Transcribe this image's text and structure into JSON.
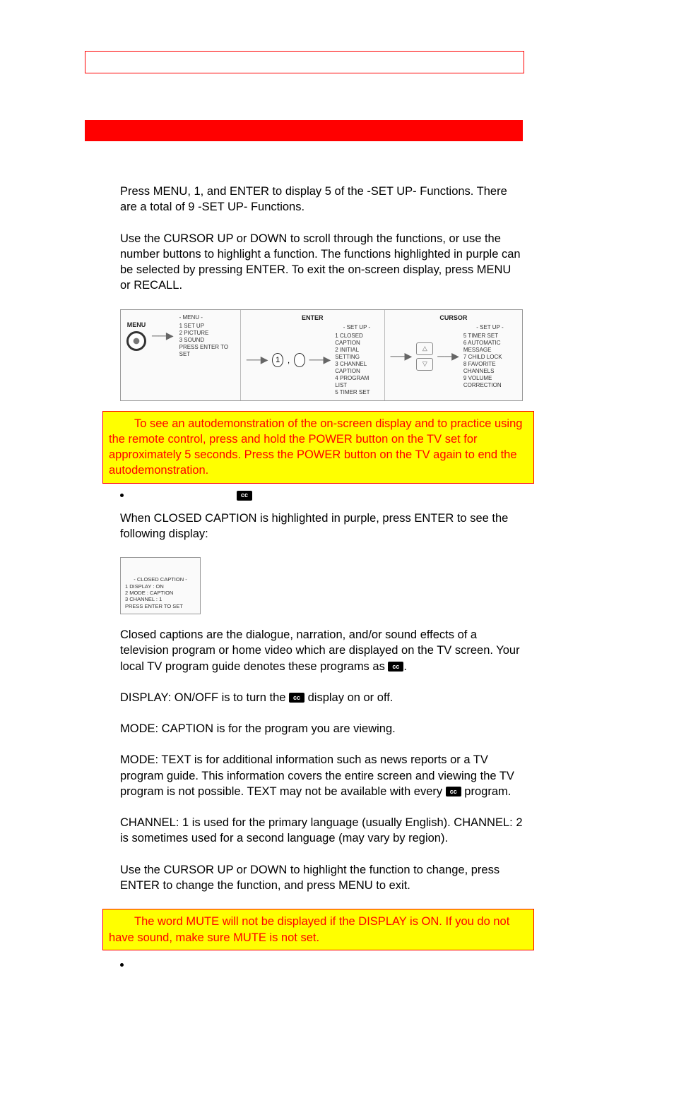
{
  "intro": {
    "p1": "Press MENU, 1, and ENTER to display 5 of the -SET UP- Functions. There are a total of 9 -SET UP- Functions.",
    "p2": "Use the CURSOR UP or DOWN to scroll through the functions, or use the number buttons to highlight a function. The functions highlighted in purple can be selected by pressing ENTER. To exit the on-screen display, press MENU or RECALL."
  },
  "diagram": {
    "menu_label": "MENU",
    "enter_label": "ENTER",
    "cursor_label": "CURSOR",
    "num1": "1",
    "comma": ",",
    "menu_screen": {
      "title": "- MENU -",
      "items": [
        "1  SET UP",
        "2  PICTURE",
        "3  SOUND"
      ],
      "footer": "PRESS ENTER TO SET"
    },
    "setup_screen_1": {
      "title": "- SET UP -",
      "items": [
        "1  CLOSED CAPTION",
        "2  INITIAL SETTING",
        "3  CHANNEL CAPTION",
        "4  PROGRAM LIST",
        "5  TIMER SET"
      ]
    },
    "setup_screen_2": {
      "title": "- SET UP -",
      "items": [
        "5  TIMER SET",
        "6  AUTOMATIC MESSAGE",
        "7  CHILD LOCK",
        "8  FAVORITE CHANNELS",
        "9  VOLUME CORRECTION"
      ]
    },
    "cursor_up": "△",
    "cursor_down": "▽"
  },
  "note1": "To see an autodemonstration of the on-screen display and to practice using the remote control, press and hold the POWER button on the TV set for approximately 5 seconds. Press the POWER button on the TV again to end the autodemonstration.",
  "closed_caption": {
    "heading_icon_name": "closed-caption-icon",
    "p1": "When CLOSED CAPTION is highlighted in purple, press ENTER to see the following display:",
    "screen": {
      "title": "- CLOSED CAPTION -",
      "items": [
        "1  DISPLAY   : ON",
        "2  MODE        : CAPTION",
        "3  CHANNEL : 1"
      ],
      "footer": "PRESS ENTER TO SET"
    },
    "p2a": "Closed captions are the dialogue, narration, and/or sound effects of a television program or home video which are displayed on the TV screen. Your local TV program guide denotes these programs as ",
    "p2b": ".",
    "p3a": "DISPLAY: ON/OFF is to turn the ",
    "p3b": " display on or off.",
    "p4": "MODE: CAPTION is for the program you are viewing.",
    "p5a": "MODE: TEXT is for additional information such as news reports or a TV program guide.  This information covers the entire screen and viewing the TV program is not possible. TEXT may not be available with every ",
    "p5b": " program.",
    "p6": "CHANNEL: 1 is used for the primary language (usually English). CHANNEL: 2 is sometimes used for a second language (may vary by region).",
    "p7": "Use the CURSOR UP or DOWN to highlight the function to change, press ENTER to change the function, and press MENU to exit."
  },
  "note2": "The word MUTE will not be displayed if the DISPLAY is ON.  If you do not have sound, make sure MUTE is not set."
}
